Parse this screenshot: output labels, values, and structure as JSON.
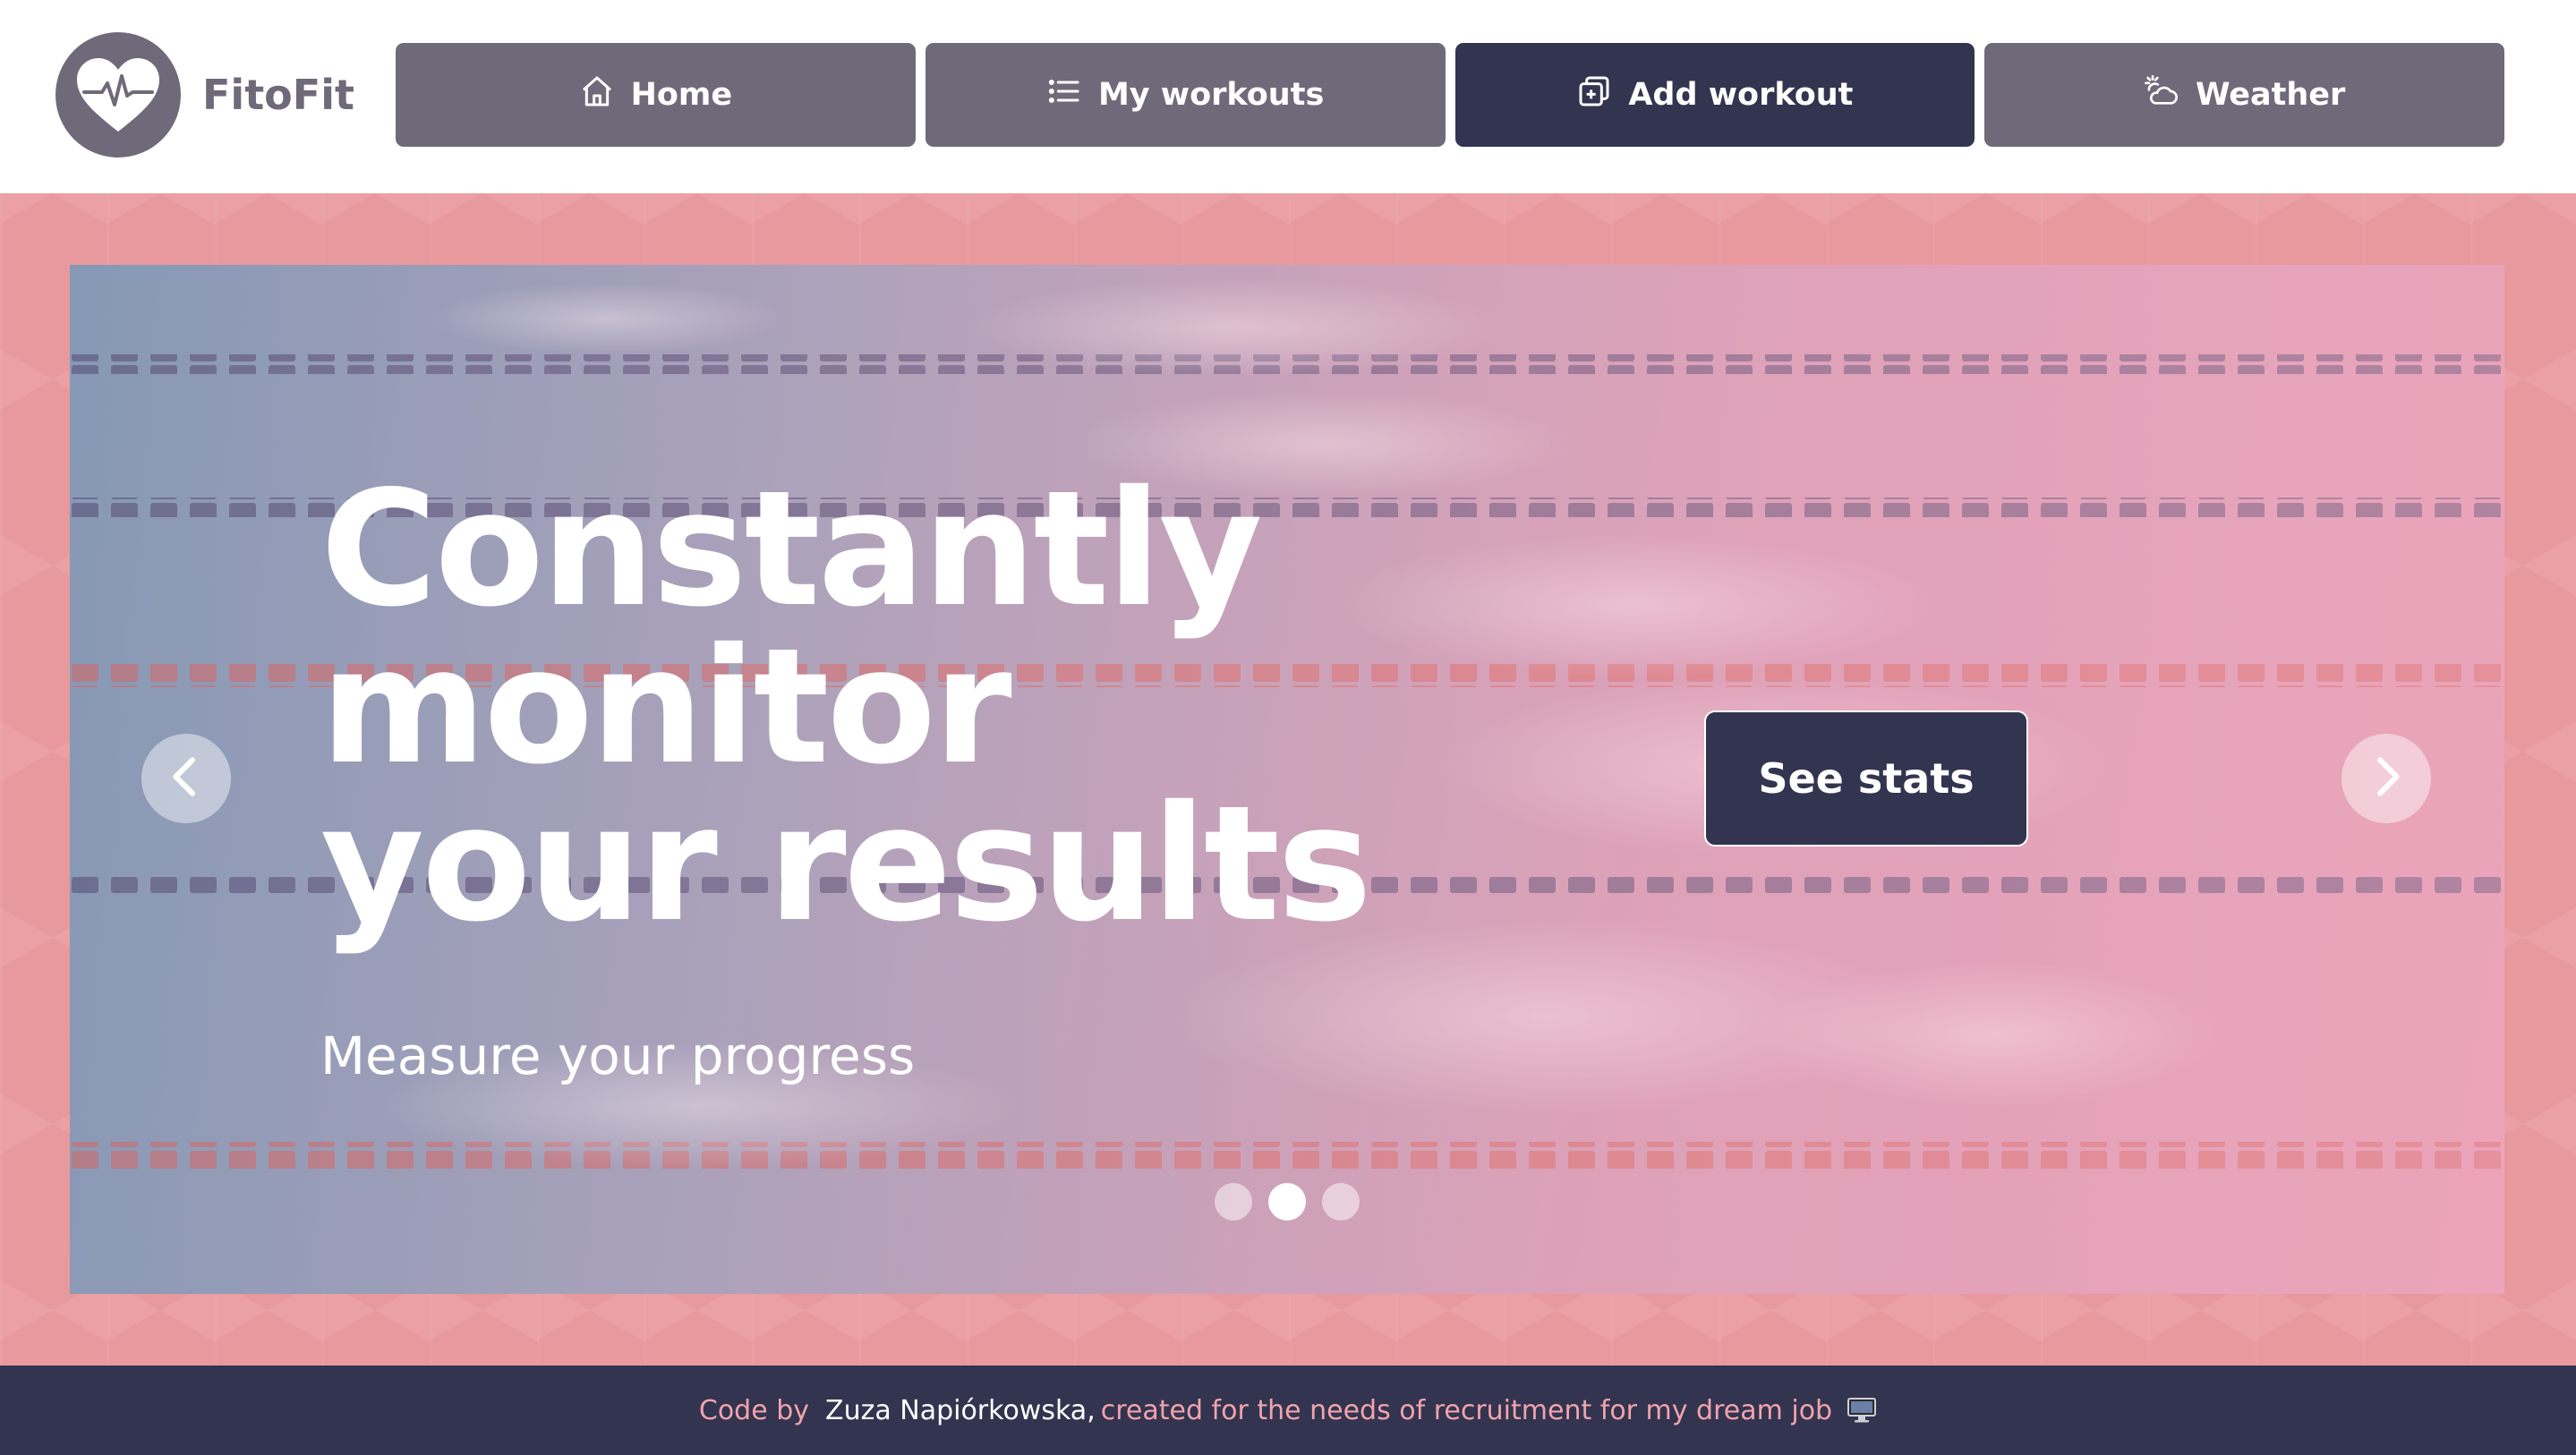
{
  "brand": {
    "name": "FitoFit"
  },
  "nav": {
    "items": [
      {
        "label": "Home",
        "icon": "home-icon"
      },
      {
        "label": "My workouts",
        "icon": "list-icon"
      },
      {
        "label": "Add workout",
        "icon": "add-square-icon",
        "active": true
      },
      {
        "label": "Weather",
        "icon": "sun-cloud-icon"
      }
    ]
  },
  "hero": {
    "title": "Constantly monitor your results",
    "subtitle": "Measure your progress",
    "cta_label": "See stats",
    "active_slide": 2,
    "slide_count": 3
  },
  "footer": {
    "prefix": "Code by",
    "author": "Zuza Napiórkowska,",
    "suffix": "created for the needs of recruitment for my dream job"
  },
  "colors": {
    "nav_bg": "#6f6a79",
    "nav_active_bg": "#33344f",
    "band_bg": "#e8999e",
    "footer_bg": "#33344f",
    "footer_text": "#f0a3ac"
  }
}
